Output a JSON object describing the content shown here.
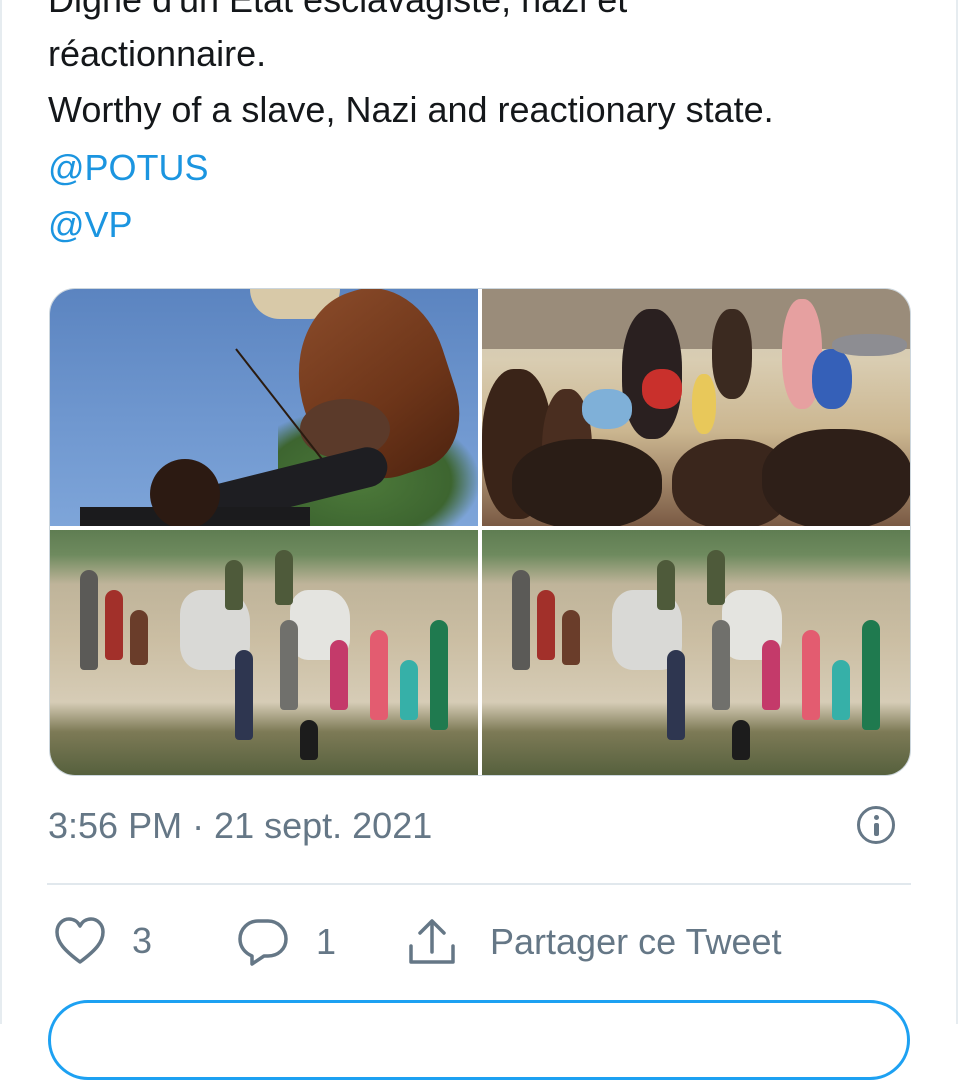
{
  "tweet": {
    "text_lines": [
      "Digne d'un Etat esclavagiste, nazi et",
      "réactionnaire.",
      "Worthy of a slave, Nazi and reactionary state."
    ],
    "mentions": [
      "@POTUS",
      "@VP"
    ]
  },
  "media": {
    "photo_count": 4
  },
  "meta": {
    "timestamp": "3:56 PM · 21 sept. 2021",
    "info_icon": "info-icon"
  },
  "actions": {
    "like_count": "3",
    "reply_count": "1",
    "share_label": "Partager ce Tweet",
    "icons": [
      "heart-icon",
      "reply-bubble-icon",
      "share-icon"
    ]
  },
  "colors": {
    "link": "#1b95e0",
    "meta_gray": "#657786",
    "divider": "#e1e8ed",
    "accent": "#1da1f2"
  }
}
